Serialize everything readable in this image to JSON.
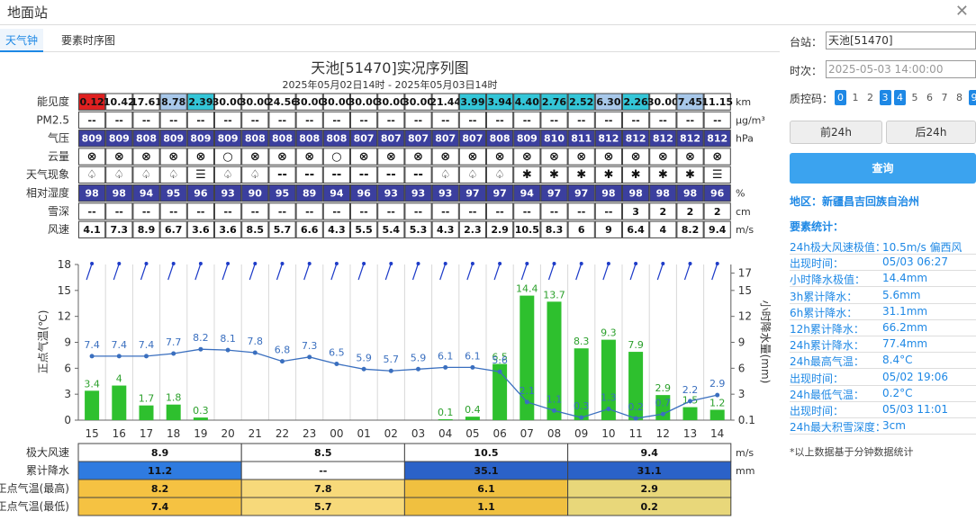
{
  "window": {
    "title": "地面站"
  },
  "tabs": [
    {
      "label": "天气钟"
    },
    {
      "label": "要素时序图"
    }
  ],
  "chart_title": "天池[51470]实况序列图",
  "chart_subtitle": "2025年05月02日14时 - 2025年05月03日14时",
  "table": {
    "rows": [
      {
        "label": "能见度",
        "unit": "km",
        "values": [
          "0.12",
          "10.42",
          "17.61",
          "8.78",
          "2.39",
          "30.00",
          "30.00",
          "24.56",
          "30.00",
          "30.00",
          "30.00",
          "30.00",
          "30.00",
          "21.44",
          "3.99",
          "3.94",
          "4.40",
          "2.76",
          "2.52",
          "6.30",
          "2.26",
          "30.00",
          "7.45",
          "11.15"
        ]
      },
      {
        "label": "PM2.5",
        "unit": "μg/m³",
        "values": [
          "--",
          "--",
          "--",
          "--",
          "--",
          "--",
          "--",
          "--",
          "--",
          "--",
          "--",
          "--",
          "--",
          "--",
          "--",
          "--",
          "--",
          "--",
          "--",
          "--",
          "--",
          "--",
          "--",
          "--"
        ]
      },
      {
        "label": "气压",
        "unit": "hPa",
        "values": [
          "809",
          "809",
          "808",
          "809",
          "809",
          "809",
          "808",
          "808",
          "808",
          "808",
          "807",
          "807",
          "807",
          "807",
          "807",
          "808",
          "809",
          "810",
          "811",
          "812",
          "812",
          "812",
          "812",
          "812"
        ]
      },
      {
        "label": "云量",
        "unit": "",
        "values": [
          "⊗",
          "⊗",
          "⊗",
          "⊗",
          "⊗",
          "○",
          "⊗",
          "⊗",
          "⊗",
          "○",
          "⊗",
          "⊗",
          "⊗",
          "⊗",
          "⊗",
          "⊗",
          "⊗",
          "⊗",
          "⊗",
          "⊗",
          "⊗",
          "⊗",
          "⊗",
          "⊗"
        ]
      },
      {
        "label": "天气现象",
        "unit": "",
        "values": [
          "♤",
          "♤",
          "♤",
          "♤",
          "☰",
          "♤",
          "♤",
          "--",
          "--",
          "--",
          "--",
          "--",
          "--",
          "♤",
          "♤",
          "♤",
          "✱",
          "✱",
          "✱",
          "✱",
          "✱",
          "✱",
          "✱",
          "☰"
        ]
      },
      {
        "label": "相对湿度",
        "unit": "%",
        "values": [
          "98",
          "98",
          "94",
          "95",
          "96",
          "93",
          "90",
          "95",
          "89",
          "94",
          "96",
          "93",
          "93",
          "93",
          "97",
          "97",
          "94",
          "97",
          "97",
          "98",
          "98",
          "98",
          "98",
          "96"
        ]
      },
      {
        "label": "雪深",
        "unit": "cm",
        "values": [
          "--",
          "--",
          "--",
          "--",
          "--",
          "--",
          "--",
          "--",
          "--",
          "--",
          "--",
          "--",
          "--",
          "--",
          "--",
          "--",
          "--",
          "--",
          "--",
          "--",
          "3",
          "2",
          "2",
          "2"
        ]
      },
      {
        "label": "风速",
        "unit": "m/s",
        "values": [
          "4.1",
          "7.3",
          "8.9",
          "6.7",
          "3.6",
          "3.6",
          "8.5",
          "5.7",
          "6.6",
          "4.3",
          "5.5",
          "5.4",
          "5.3",
          "4.3",
          "2.3",
          "2.9",
          "10.5",
          "8.3",
          "6",
          "9",
          "6.4",
          "4",
          "8.2",
          "9.4"
        ]
      }
    ]
  },
  "chart_data": {
    "type": "bar+line",
    "categories": [
      "15",
      "16",
      "17",
      "18",
      "19",
      "20",
      "21",
      "22",
      "23",
      "00",
      "01",
      "02",
      "03",
      "04",
      "05",
      "06",
      "07",
      "08",
      "09",
      "10",
      "11",
      "12",
      "13",
      "14"
    ],
    "ylabel_left": "正点气温(℃)",
    "ylabel_right": "小时降水量(mm)",
    "ylim_left": [
      0,
      18
    ],
    "yticks_left": [
      "0",
      "3",
      "6",
      "9",
      "12",
      "15",
      "18"
    ],
    "yticks_right": [
      "0.1",
      "3",
      "6",
      "9",
      "12",
      "15",
      "17"
    ],
    "series": [
      {
        "name": "小时降水量",
        "type": "bar",
        "color": "#3cc83c",
        "values": [
          3.4,
          4,
          1.7,
          1.8,
          0.3,
          null,
          null,
          null,
          null,
          null,
          null,
          null,
          null,
          0.1,
          0.4,
          6.5,
          14.4,
          13.7,
          8.3,
          9.3,
          7.9,
          2.9,
          1.5,
          1.2
        ]
      },
      {
        "name": "正点气温",
        "type": "line",
        "color": "#3a6fbf",
        "values": [
          7.4,
          7.4,
          7.4,
          7.7,
          8.2,
          8.1,
          7.8,
          6.8,
          7.3,
          6.5,
          5.9,
          5.7,
          5.9,
          6.1,
          6.1,
          5.6,
          2.1,
          1.1,
          0.3,
          1.3,
          0.2,
          0.7,
          2.2,
          2.9
        ]
      }
    ],
    "bar_labels": [
      "3.4",
      "4",
      "1.7",
      "1.8",
      "0.3",
      "",
      "",
      "",
      "",
      "",
      "",
      "",
      "",
      "0.1",
      "0.4",
      "6.5",
      "14.4",
      "13.7",
      "8.3",
      "9.3",
      "7.9",
      "2.9",
      "1.5",
      "1.2"
    ],
    "line_labels": [
      "7.4",
      "7.4",
      "7.4",
      "7.7",
      "8.2",
      "8.1",
      "7.8",
      "6.8",
      "7.3",
      "6.5",
      "5.9",
      "5.7",
      "5.9",
      "6.1",
      "6.1",
      "5.6",
      "2.1",
      "1.1",
      "0.3",
      "1.3",
      "0.2",
      "0.7",
      "2.2",
      "2.9"
    ]
  },
  "summary": {
    "rows": [
      {
        "label": "极大风速",
        "unit": "m/s",
        "cells": [
          "8.9",
          "8.5",
          "10.5",
          "9.4"
        ]
      },
      {
        "label": "累计降水",
        "unit": "mm",
        "cells": [
          "11.2",
          "--",
          "35.1",
          "31.1"
        ]
      },
      {
        "label": "正点气温(最高)",
        "unit": "",
        "cells": [
          "8.2",
          "7.8",
          "6.1",
          "2.9"
        ]
      },
      {
        "label": "正点气温(最低)",
        "unit": "",
        "cells": [
          "7.4",
          "5.7",
          "1.1",
          "0.2"
        ]
      }
    ],
    "rain_colors": [
      "#2f7be0",
      "#ffffff",
      "#2b62c8",
      "#2b62c8"
    ],
    "temp_colors": [
      "#f5c242",
      "#f7d97a",
      "#f0c040",
      "#e8d77a"
    ]
  },
  "side": {
    "station_label": "台站：",
    "station_value": "天池[51470]",
    "time_label": "时次：",
    "time_value": "2025-05-03 14:00:00",
    "qc_label": "质控码：",
    "qc_codes": [
      "0",
      "1",
      "2",
      "3",
      "4",
      "5",
      "6",
      "7",
      "8",
      "9"
    ],
    "qc_selected": [
      "0",
      "3",
      "4",
      "9"
    ],
    "prev_button": "前24h",
    "next_button": "后24h",
    "query_button": "查询",
    "region": "地区：新疆昌吉回族自治州",
    "stats_title": "要素统计：",
    "stats": [
      {
        "k": "24h极大风速极值：",
        "v": "10.5m/s 偏西风"
      },
      {
        "k": "出现时间：",
        "v": "05/03 06:27"
      },
      {
        "k": "小时降水极值：",
        "v": "14.4mm"
      },
      {
        "k": "3h累计降水：",
        "v": "5.6mm"
      },
      {
        "k": "6h累计降水：",
        "v": "31.1mm"
      },
      {
        "k": "12h累计降水：",
        "v": "66.2mm"
      },
      {
        "k": "24h累计降水：",
        "v": "77.4mm"
      },
      {
        "k": "24h最高气温：",
        "v": "8.4°C"
      },
      {
        "k": "出现时间：",
        "v": "05/02 19:06"
      },
      {
        "k": "24h最低气温：",
        "v": "0.2°C"
      },
      {
        "k": "出现时间：",
        "v": "05/03 11:01"
      },
      {
        "k": "24h最大积雪深度：",
        "v": "3cm"
      }
    ],
    "note": "*以上数据基于分钟数据统计"
  }
}
